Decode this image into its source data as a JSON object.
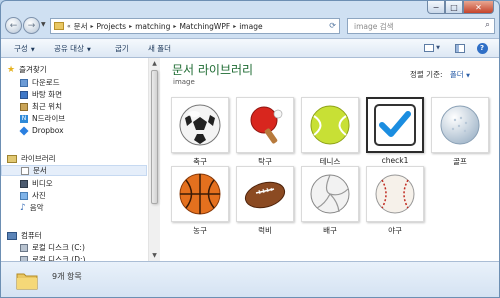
{
  "window": {
    "caption_buttons": [
      "minimize",
      "maximize",
      "close"
    ]
  },
  "address_bar": {
    "segments": [
      "문서",
      "Projects",
      "matching",
      "MatchingWPF",
      "image"
    ]
  },
  "search": {
    "placeholder": "image 검색"
  },
  "toolbar": {
    "organize": "구성",
    "share": "공유 대상",
    "burn": "굽기",
    "new_folder": "새 폴더"
  },
  "sidebar": {
    "favorites": {
      "header": "즐겨찾기",
      "items": [
        "다운로드",
        "바탕 화면",
        "최근 위치",
        "N드라이브",
        "Dropbox"
      ]
    },
    "libraries": {
      "header": "라이브러리",
      "items": [
        "문서",
        "비디오",
        "사진",
        "음악"
      ],
      "selected": "문서"
    },
    "computer": {
      "header": "컴퓨터",
      "items": [
        "로컬 디스크 (C:)",
        "로컬 디스크 (D:)"
      ]
    }
  },
  "library": {
    "title": "문서 라이브러리",
    "subtitle": "image",
    "arrange_label": "정렬 기준:",
    "arrange_value": "폴더"
  },
  "files": [
    {
      "name": "축구",
      "icon": "soccer-ball-icon"
    },
    {
      "name": "탁구",
      "icon": "ping-pong-paddle-icon"
    },
    {
      "name": "테니스",
      "icon": "tennis-ball-icon"
    },
    {
      "name": "check1",
      "icon": "checkmark-icon"
    },
    {
      "name": "골프",
      "icon": "golf-ball-icon"
    },
    {
      "name": "농구",
      "icon": "basketball-icon"
    },
    {
      "name": "럭비",
      "icon": "rugby-ball-icon"
    },
    {
      "name": "배구",
      "icon": "volleyball-icon"
    },
    {
      "name": "야구",
      "icon": "baseball-icon"
    }
  ],
  "status": {
    "text": "9개 항목"
  },
  "colors": {
    "library_title": "#1e6b32",
    "selection": "#e5eefa",
    "window_frame": "#cfe0f2"
  }
}
